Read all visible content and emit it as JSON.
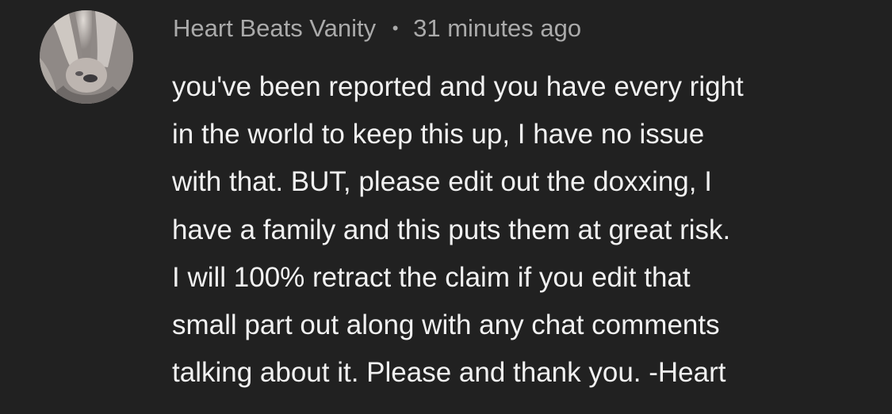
{
  "comment": {
    "author": "Heart Beats Vanity",
    "separator": "•",
    "timestamp": "31 minutes ago",
    "avatar_icon": "user-avatar-photo",
    "lines": [
      "you've been reported and you have every right",
      "in the world to keep this up, I have no issue",
      "with that. BUT, please edit out the doxxing, I",
      "have a family and this puts them at great risk.",
      "I will 100% retract the claim if you edit that",
      "small part out along with any chat comments",
      "talking about it. Please and thank you. -Heart"
    ]
  },
  "colors": {
    "background": "#212121",
    "meta_text": "#aaaaaa",
    "body_text": "#f1f1f1"
  }
}
